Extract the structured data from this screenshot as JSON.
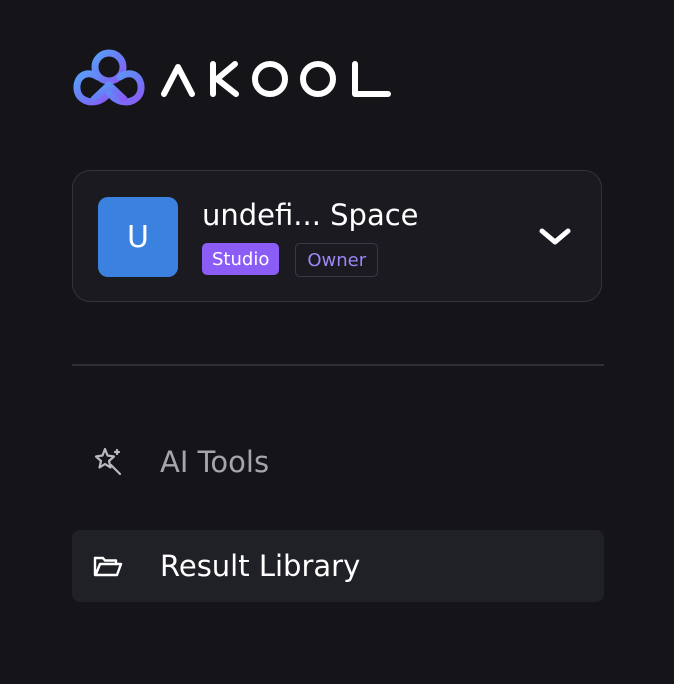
{
  "brand": {
    "wordmark": "AKOOL",
    "logo_icon": "akool-cloud-logo-icon",
    "gradient_colors": [
      "#5b7cf5",
      "#7c5cf6"
    ]
  },
  "workspace": {
    "avatar_letter": "U",
    "avatar_color": "#3b82e0",
    "name": "undefi... Space",
    "badges": {
      "plan": "Studio",
      "role": "Owner"
    },
    "plan_badge_color": "#8b5cf6",
    "expand_icon": "chevron-down-icon"
  },
  "nav": {
    "items": [
      {
        "label": "AI Tools",
        "icon": "magic-wand-sparkle-icon",
        "active": false
      },
      {
        "label": "Result Library",
        "icon": "folder-open-icon",
        "active": true
      }
    ]
  }
}
